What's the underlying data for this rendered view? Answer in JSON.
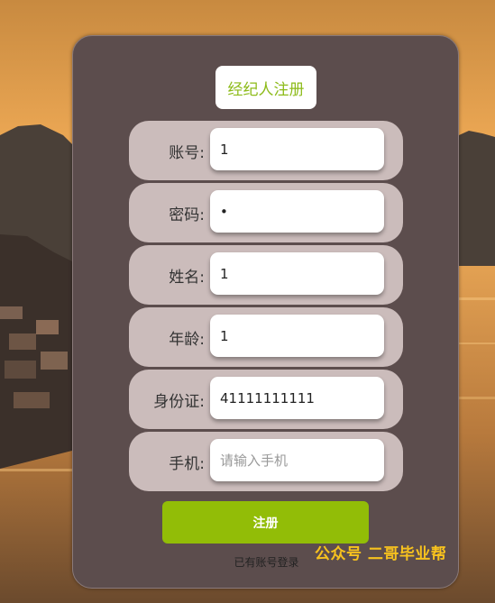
{
  "form": {
    "title": "经纪人注册",
    "fields": [
      {
        "label": "账号:",
        "value": "1",
        "placeholder": ""
      },
      {
        "label": "密码:",
        "value": "•",
        "placeholder": ""
      },
      {
        "label": "姓名:",
        "value": "1",
        "placeholder": ""
      },
      {
        "label": "年龄:",
        "value": "1",
        "placeholder": ""
      },
      {
        "label": "身份证:",
        "value": "41111111111",
        "placeholder": ""
      },
      {
        "label": "手机:",
        "value": "",
        "placeholder": "请输入手机"
      }
    ],
    "submit_label": "注册",
    "login_link": "已有账号登录"
  },
  "watermark": "公众号 二哥毕业帮",
  "colors": {
    "card": "#5c4d4d",
    "row": "#cbbcbb",
    "accent": "#92bd07",
    "title_text": "#8dbb1a",
    "watermark": "#f7c21e"
  }
}
